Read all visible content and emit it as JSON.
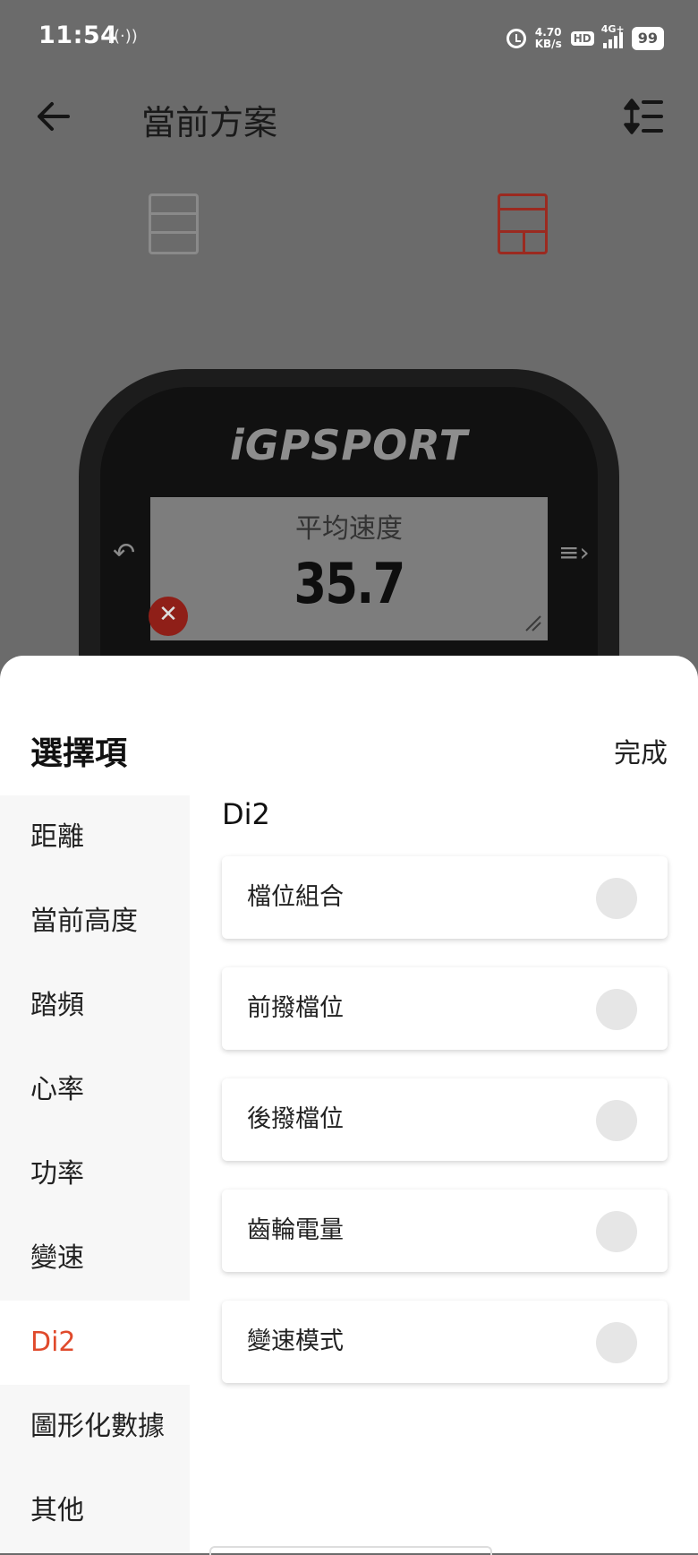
{
  "status_bar": {
    "time": "11:54",
    "nfc_icon": "nfc-icon",
    "speed_value": "4.70",
    "speed_unit": "KB/s",
    "hd_label": "HD",
    "network_label": "4G+",
    "battery": "99"
  },
  "header": {
    "title": "當前方案",
    "back_icon": "arrow-left-icon",
    "sort_icon": "sort-icon"
  },
  "layout_tabs": [
    {
      "icon": "three-row-layout-icon",
      "selected": false
    },
    {
      "icon": "split-layout-icon",
      "selected": true
    }
  ],
  "device_preview": {
    "brand": "iGPSPORT",
    "metric_label": "平均速度",
    "metric_value": "35.7"
  },
  "sheet": {
    "title": "選擇項",
    "done_label": "完成",
    "categories": [
      {
        "label": "距離",
        "active": false
      },
      {
        "label": "當前高度",
        "active": false
      },
      {
        "label": "踏頻",
        "active": false
      },
      {
        "label": "心率",
        "active": false
      },
      {
        "label": "功率",
        "active": false
      },
      {
        "label": "變速",
        "active": false
      },
      {
        "label": "Di2",
        "active": true
      },
      {
        "label": "圖形化數據",
        "active": false
      },
      {
        "label": "其他",
        "active": false
      }
    ],
    "section_title": "Di2",
    "options": [
      {
        "label": "檔位組合",
        "selected": false
      },
      {
        "label": "前撥檔位",
        "selected": false
      },
      {
        "label": "後撥檔位",
        "selected": false
      },
      {
        "label": "齒輪電量",
        "selected": false
      },
      {
        "label": "變速模式",
        "selected": false
      }
    ]
  },
  "colors": {
    "accent": "#e04a2c",
    "scrim": "#6b6b6b",
    "toggle_off": "#e6e6e6"
  }
}
